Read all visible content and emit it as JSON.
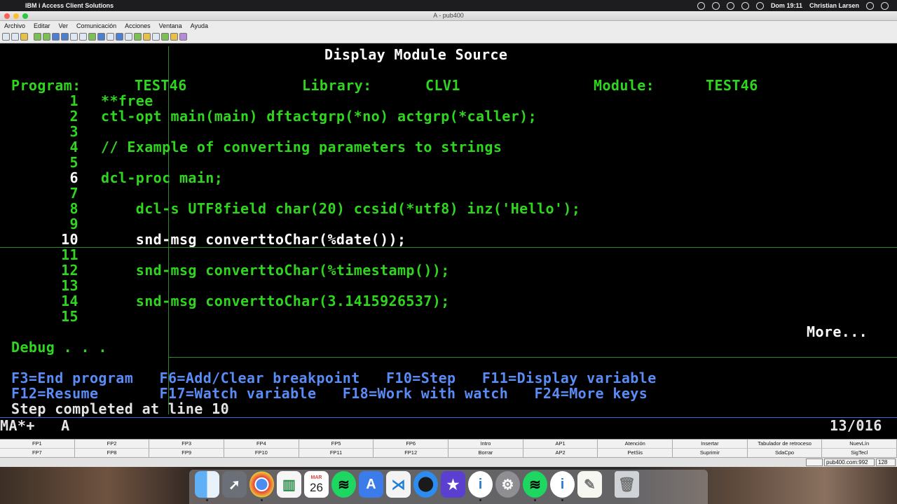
{
  "menubar": {
    "app_name": "IBM i Access Client Solutions",
    "clock": "Dom 19:11",
    "user": "Christian Larsen"
  },
  "window": {
    "title": "A - pub400"
  },
  "app_menu": [
    "Archivo",
    "Editar",
    "Ver",
    "Comunicación",
    "Acciones",
    "Ventana",
    "Ayuda"
  ],
  "terminal": {
    "screen_title": "Display Module Source",
    "header_program_label": "Program:",
    "header_program_value": "TEST46",
    "header_library_label": "Library:",
    "header_library_value": "CLV1",
    "header_module_label": "Module:",
    "header_module_value": "TEST46",
    "source_lines": [
      {
        "num": "1",
        "code": "**free"
      },
      {
        "num": "2",
        "code": "ctl-opt main(main) dftactgrp(*no) actgrp(*caller);"
      },
      {
        "num": "3",
        "code": ""
      },
      {
        "num": "4",
        "code": "// Example of converting parameters to strings"
      },
      {
        "num": "5",
        "code": ""
      },
      {
        "num": "6",
        "code": "dcl-proc main;"
      },
      {
        "num": "7",
        "code": ""
      },
      {
        "num": "8",
        "code": "    dcl-s UTF8field char(20) ccsid(*utf8) inz('Hello');"
      },
      {
        "num": "9",
        "code": ""
      },
      {
        "num": "10",
        "code": "    snd-msg converttoChar(%date());"
      },
      {
        "num": "11",
        "code": ""
      },
      {
        "num": "12",
        "code": "    snd-msg converttoChar(%timestamp());"
      },
      {
        "num": "13",
        "code": ""
      },
      {
        "num": "14",
        "code": "    snd-msg converttoChar(3.1415926537);"
      },
      {
        "num": "15",
        "code": ""
      }
    ],
    "more": "More...",
    "debug_prompt": "Debug . . .",
    "function_key_lines": [
      "F3=End program   F6=Add/Clear breakpoint   F10=Step   F11=Display variable",
      "F12=Resume       F17=Watch variable   F18=Work with watch   F24=More keys"
    ],
    "message": "Step completed at line 10",
    "oia_left": "MA*+   A",
    "oia_right": "13/016"
  },
  "fkeys": {
    "row1": [
      "FP1",
      "FP2",
      "FP3",
      "FP4",
      "FP5",
      "FP6",
      "Intro",
      "AP1",
      "Atención",
      "Insertar",
      "Tabulador de retroceso",
      "NuevLín"
    ],
    "row2": [
      "FP7",
      "FP8",
      "FP9",
      "FP10",
      "FP11",
      "FP12",
      "Borrar",
      "AP2",
      "PetSis",
      "Suprimir",
      "SdaCpo",
      "SigTecl"
    ]
  },
  "statusbar": {
    "host": "pub400.com:992",
    "bits": "128"
  },
  "dock": {
    "calendar_month": "MAR",
    "calendar_day": "26"
  },
  "colors": {
    "terminal_green": "#2fd51f",
    "terminal_white": "#ffffff",
    "terminal_blue": "#5a8cf5",
    "terminal_bg": "#000000"
  }
}
